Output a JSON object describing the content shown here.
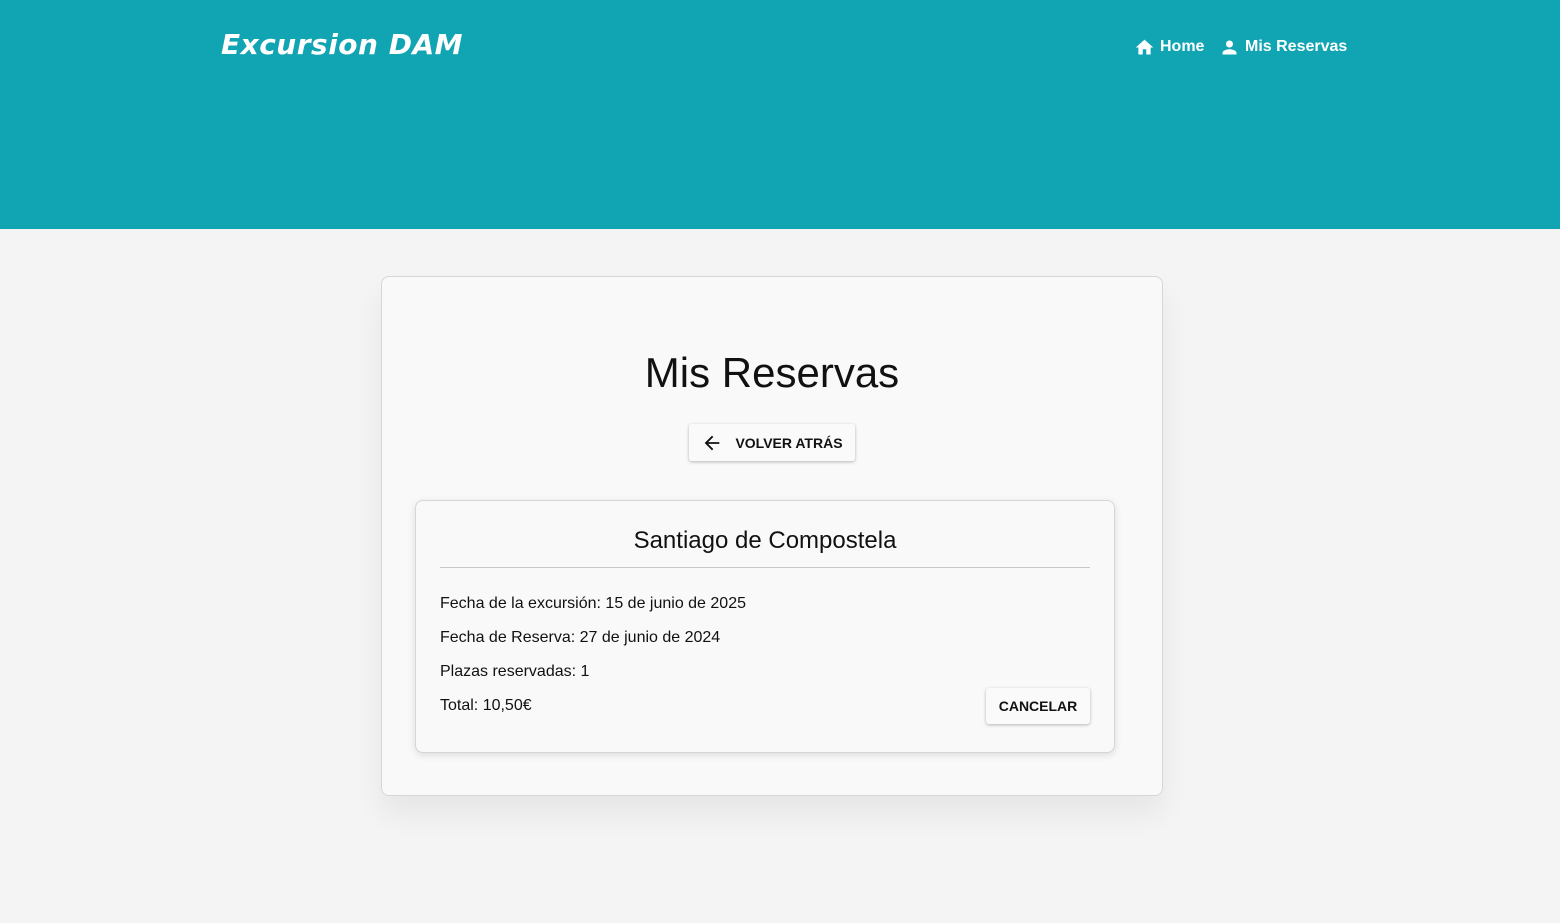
{
  "header": {
    "brand": "Excursion DAM",
    "nav": [
      {
        "label": "Home",
        "icon": "home-icon"
      },
      {
        "label": "Mis Reservas",
        "icon": "user-icon"
      }
    ],
    "color": "#11a4b3"
  },
  "main": {
    "title": "Mis Reservas",
    "back_button": "VOLVER ATRÁS",
    "reservation": {
      "destination": "Santiago de Compostela",
      "excursion_date": "Fecha de la excursión: 15 de junio de 2025",
      "booking_date": "Fecha de Reserva: 27 de junio de 2024",
      "seats": "Plazas reservadas: 1",
      "total": "Total: 10,50€",
      "cancel_button": "CANCELAR"
    }
  }
}
